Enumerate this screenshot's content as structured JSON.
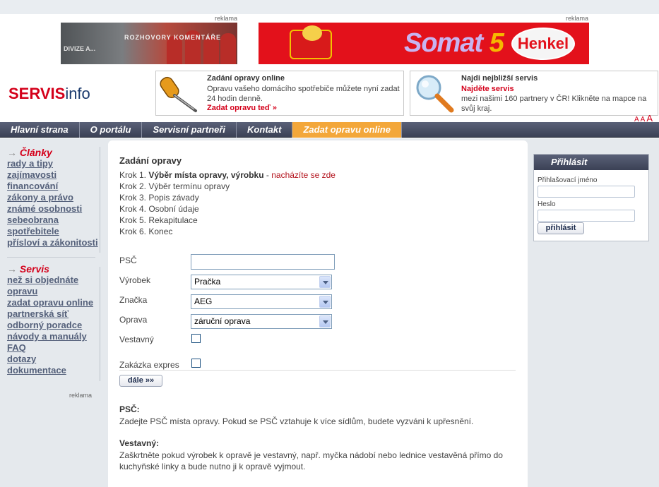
{
  "ads": {
    "label_left": "reklama",
    "label_right": "reklama",
    "banner_left": {
      "text_top": "ROZHOVORY KOMENTÁŘE",
      "text_bottom": "DIVIZE A..."
    },
    "banner_right": {
      "brand": "Somat",
      "brand_number": "5",
      "maker": "Henkel"
    }
  },
  "logo": {
    "part1": "SERVIS",
    "part2": "info"
  },
  "promo_repair": {
    "title": "Zadání opravy online",
    "text": "Opravu vašeho domácího spotřebiče můžete nyní zadat 24 hodin denně.",
    "link": "Zadat opravu teď »",
    "icon": "screwdriver-icon"
  },
  "promo_service": {
    "title": "Najdi nejbližší servis",
    "subtitle": "Najděte servis",
    "text": "mezi našimi 160 partnery v ČR! Klikněte na mapce na svůj kraj.",
    "icon": "magnifier-icon"
  },
  "font_size_controls": [
    "A",
    "A",
    "A"
  ],
  "nav": {
    "items": [
      "Hlavní strana",
      "O portálu",
      "Servisní partneři",
      "Kontakt",
      "Zadat opravu online"
    ]
  },
  "sidebar": {
    "section1_title": "Články",
    "section1_links": [
      "rady a tipy",
      "zajímavosti",
      "financování",
      "zákony a právo",
      "známé osobnosti",
      "sebeobrana",
      "spotřebitele",
      "přísloví a zákonitosti"
    ],
    "section2_title": "Servis",
    "section2_links": [
      "než si objednáte",
      "opravu",
      "zadat opravu online",
      "partnerská síť",
      "odborný poradce",
      "návody a manuály",
      "FAQ",
      "dotazy",
      "dokumentace"
    ],
    "reklama": "reklama",
    "arrow": "→"
  },
  "form": {
    "heading": "Zadání opravy",
    "steps": {
      "s1_prefix": "Krok 1.",
      "s1_bold": "Výběr místa opravy, výrobku",
      "s1_sep": "-",
      "s1_here": "nacházíte se zde",
      "s2": "Krok 2. Výběr termínu opravy",
      "s3": "Krok 3. Popis závady",
      "s4": "Krok 4. Osobní údaje",
      "s5": "Krok 5. Rekapitulace",
      "s6": "Krok 6. Konec"
    },
    "psc_label": "PSČ",
    "psc_value": "",
    "product_label": "Výrobek",
    "product_value": "Pračka",
    "brand_label": "Značka",
    "brand_value": "AEG",
    "repair_label": "Oprava",
    "repair_value": "záruční oprava",
    "builtin_label": "Vestavný",
    "builtin_checked": false,
    "express_label": "Zakázka expres",
    "express_checked": false,
    "next_button": "dále »»"
  },
  "help": {
    "psc_title": "PSČ:",
    "psc_text": "Zadejte PSČ místa opravy. Pokud se PSČ vztahuje k více sídlům, budete vyzváni k upřesnění.",
    "builtin_title": "Vestavný:",
    "builtin_text": "Zaškrtněte pokud výrobek k opravě je vestavný, např. myčka nádobí nebo lednice vestavěná přímo do kuchyňské linky a bude nutno ji k opravě vyjmout."
  },
  "login": {
    "title": "Přihlásit",
    "username_label": "Přihlašovací jméno",
    "password_label": "Heslo",
    "submit": "přihlásit"
  },
  "colors": {
    "brand_red": "#d4001a",
    "nav_dark": "#3b4155",
    "nav_active": "#f3a73a",
    "sidebar_link": "#54607a"
  }
}
